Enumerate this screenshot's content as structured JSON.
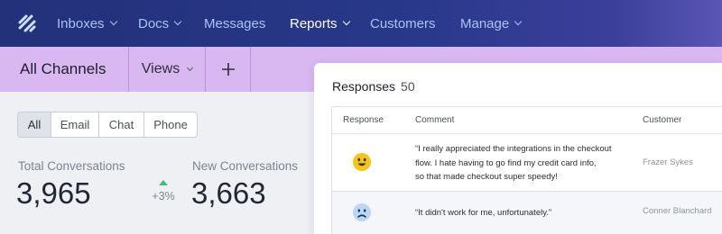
{
  "nav": {
    "items": [
      {
        "label": "Inboxes",
        "has_menu": true
      },
      {
        "label": "Docs",
        "has_menu": true
      },
      {
        "label": "Messages",
        "has_menu": false
      },
      {
        "label": "Reports",
        "has_menu": true,
        "active": true
      },
      {
        "label": "Customers",
        "has_menu": false
      },
      {
        "label": "Manage",
        "has_menu": true
      }
    ],
    "logo_icon": "helpscout-logo-icon"
  },
  "channel_bar": {
    "title": "All Channels",
    "views_label": "Views",
    "add_icon": "plus-icon"
  },
  "filters": {
    "segments": [
      "All",
      "Email",
      "Chat",
      "Phone"
    ],
    "selected": "All"
  },
  "stats": {
    "total": {
      "label": "Total Conversations",
      "value": "3,965"
    },
    "delta": {
      "value": "+3%",
      "direction": "up"
    },
    "new": {
      "label": "New Conversations",
      "value": "3,663"
    }
  },
  "responses": {
    "title": "Responses",
    "count": "50",
    "columns": [
      "Response",
      "Comment",
      "Customer"
    ],
    "rows": [
      {
        "sentiment": "happy-face-icon",
        "comment_lines": [
          "“I really appreciated the integrations in the checkout",
          "flow. I hate having to go find my credit card info,",
          "so that made checkout super speedy!"
        ],
        "customer": "Frazer Sykes"
      },
      {
        "sentiment": "sad-face-icon",
        "comment_lines": [
          "“It didn't work for me, unfortunately.”"
        ],
        "customer": "Conner Blanchard"
      }
    ]
  },
  "colors": {
    "nav_bg": "#23307a",
    "nav_text": "#a9c4f5",
    "channel_bar_bg": "#d9b8f2",
    "delta_up": "#3fbf78",
    "happy_face": "#f5c518",
    "sad_face": "#bcd6f5"
  }
}
